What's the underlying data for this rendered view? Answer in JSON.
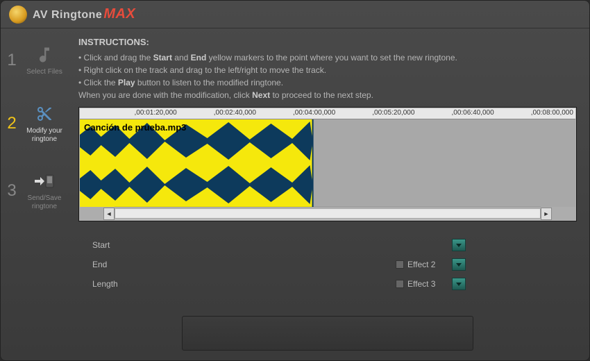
{
  "app": {
    "title_a": "AV Ringtone",
    "title_b": "MAX"
  },
  "sidebar": {
    "steps": [
      {
        "num": "1",
        "label": "Select Files"
      },
      {
        "num": "2",
        "label": "Modify your ringtone"
      },
      {
        "num": "3",
        "label": "Send/Save ringtone"
      }
    ]
  },
  "instructions": {
    "title": "INSTRUCTIONS:",
    "line1_a": "• Click and drag the ",
    "line1_b": "Start",
    "line1_c": " and ",
    "line1_d": "End",
    "line1_e": " yellow markers to the point where you want to  set the new ringtone.",
    "line2": "• Right click on the track and drag to the left/right to move the track.",
    "line3_a": "• Click the ",
    "line3_b": "Play",
    "line3_c": " button to listen to the modified ringtone.",
    "line4_a": "When you are done with the modification, click ",
    "line4_b": "Next",
    "line4_c": " to proceed to the next step."
  },
  "waveform": {
    "filename": "Canción de prueba.mp3",
    "ticks": [
      ",00:01:20,000",
      ",00:02:40,000",
      ",00:04:00,000",
      ",00:05:20,000",
      ",00:06:40,000",
      ",00:08:00,000"
    ]
  },
  "fields": {
    "start": "Start",
    "end": "End",
    "length": "Length",
    "effect2": "Effect 2",
    "effect3": "Effect 3"
  }
}
